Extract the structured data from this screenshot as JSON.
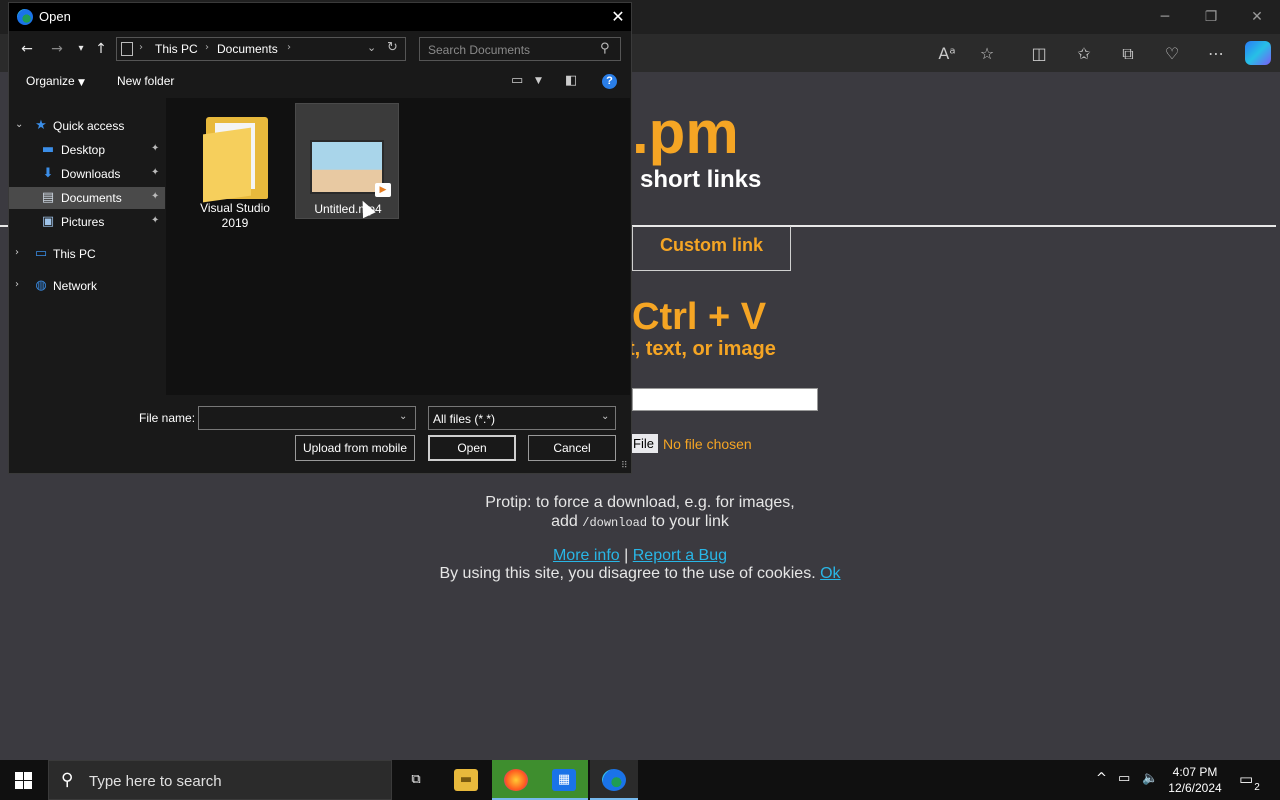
{
  "dialog": {
    "title": "Open",
    "breadcrumb": [
      "This PC",
      "Documents"
    ],
    "search_placeholder": "Search Documents",
    "organize_label": "Organize",
    "new_folder_label": "New folder",
    "help_glyph": "?",
    "nav_pane": {
      "quick_access": "Quick access",
      "items": [
        {
          "label": "Desktop",
          "icon": "desktop-icon",
          "pinned": true
        },
        {
          "label": "Downloads",
          "icon": "downloads-icon",
          "pinned": true
        },
        {
          "label": "Documents",
          "icon": "documents-icon",
          "pinned": true,
          "selected": true
        },
        {
          "label": "Pictures",
          "icon": "pictures-icon",
          "pinned": true
        }
      ],
      "this_pc": "This PC",
      "network": "Network"
    },
    "files": [
      {
        "name_line1": "Visual Studio",
        "name_line2": "2019",
        "type": "folder"
      },
      {
        "name": "Untitled.mp4",
        "type": "video"
      }
    ],
    "file_name_label": "File name:",
    "file_name_value": "",
    "filter_value": "All files (*.*)",
    "buttons": {
      "upload": "Upload from mobile",
      "open": "Open",
      "cancel": "Cancel"
    }
  },
  "page": {
    "logo_ext": ".pm",
    "tagline": "short links",
    "custom_link_tab": "Custom link",
    "paste_heading": "Ctrl + V",
    "paste_sub": "t, text, or image",
    "file_button": "File",
    "no_file": "No file chosen",
    "protip_line1": "Protip: to force a download, e.g. for images,",
    "protip_add": "add",
    "protip_code": "/download",
    "protip_suffix": "to your link",
    "more_info": "More info",
    "separator": "|",
    "report_bug": "Report a Bug",
    "cookie_text": "By using this site, you disagree to the use of cookies.",
    "cookie_ok": "Ok"
  },
  "taskbar": {
    "search_placeholder": "Type here to search",
    "time": "4:07 PM",
    "date": "12/6/2024",
    "notification_count": "2"
  },
  "colors": {
    "accent_orange": "#f5a524",
    "link_blue": "#29b6e6",
    "page_bg": "#3b3a40"
  }
}
